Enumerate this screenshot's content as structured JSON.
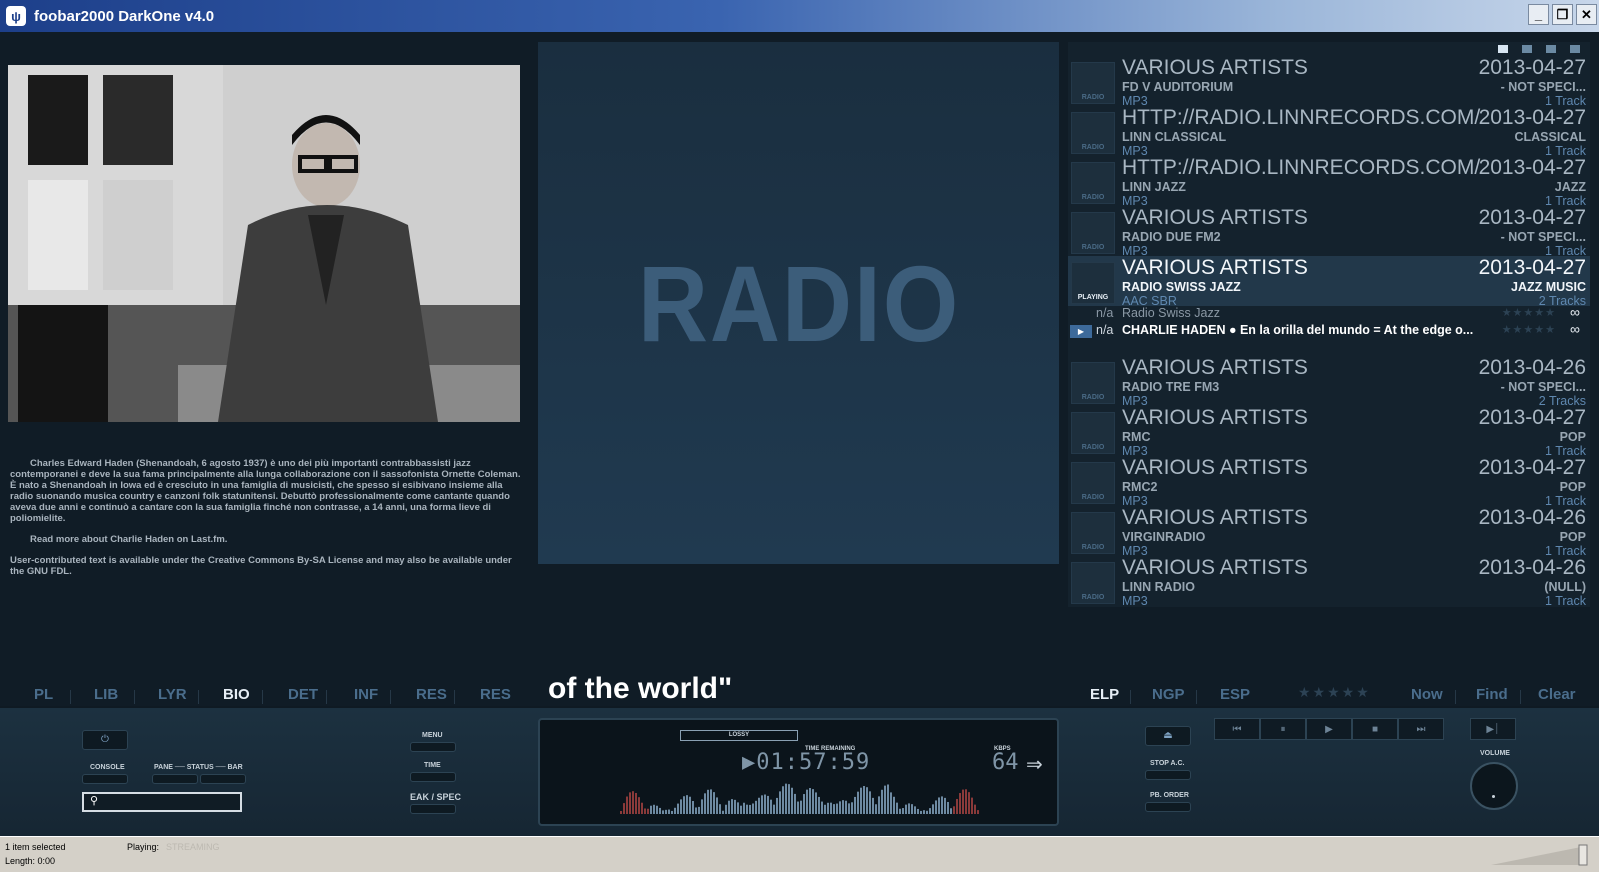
{
  "window": {
    "title": "foobar2000 DarkOne v4.0",
    "logo": "fox-icon"
  },
  "window_buttons": [
    "_",
    "❐",
    "✕"
  ],
  "bio": {
    "paragraphs": [
      "Charles Edward Haden (Shenandoah, 6 agosto 1937) è uno dei più importanti contrabbassisti jazz contemporanei e deve la sua fama principalmente alla lunga collaborazione con il sassofonista Ornette Coleman. È nato a Shenandoah in Iowa ed è cresciuto in una famiglia di musicisti, che spesso si esibivano insieme alla radio suonando musica country e canzoni folk statunitensi. Debuttò professionalmente come cantante quando aveva due anni e continuò a cantare con la sua famiglia finché non contrasse, a 14 anni, una forma lieve di poliomielite.",
      "Read more about Charlie Haden on Last.fm.",
      "User-contributed text is available under the Creative Commons By-SA License and may also be available under the GNU FDL."
    ]
  },
  "radio_panel": {
    "text": "RADIO"
  },
  "playlist": {
    "groups_top": [
      {
        "artist": "VARIOUS ARTISTS",
        "date": "2013-04-27",
        "album": "FD V AUDITORIUM",
        "genre": "- NOT SPECI...",
        "codec": "MP3",
        "tracks": "1 Track",
        "thumb": "RADIO"
      },
      {
        "artist": "HTTP://RADIO.LINNRECORDS.COM/",
        "date": "2013-04-27",
        "album": "LINN CLASSICAL",
        "genre": "CLASSICAL",
        "codec": "MP3",
        "tracks": "1 Track",
        "thumb": "RADIO"
      },
      {
        "artist": "HTTP://RADIO.LINNRECORDS.COM/",
        "date": "2013-04-27",
        "album": "LINN JAZZ",
        "genre": "JAZZ",
        "codec": "MP3",
        "tracks": "1 Track",
        "thumb": "RADIO"
      },
      {
        "artist": "VARIOUS ARTISTS",
        "date": "2013-04-27",
        "album": "RADIO DUE FM2",
        "genre": "- NOT SPECI...",
        "codec": "MP3",
        "tracks": "1 Track",
        "thumb": "RADIO"
      }
    ],
    "playing_group": {
      "artist": "VARIOUS ARTISTS",
      "date": "2013-04-27",
      "album": "RADIO SWISS JAZZ",
      "genre": "JAZZ MUSIC",
      "codec": "AAC SBR",
      "tracks": "2 Tracks",
      "thumb": "PLAYING"
    },
    "tracks": [
      {
        "na": "n/a",
        "name": "Radio Swiss Jazz",
        "stars": "★★★★★",
        "inf": "∞"
      },
      {
        "na": "n/a",
        "name": "CHARLIE HADEN ● En la orilla del mundo = At the edge o...",
        "stars": "★★★★★",
        "inf": "∞"
      }
    ],
    "groups_bottom": [
      {
        "artist": "VARIOUS ARTISTS",
        "date": "2013-04-26",
        "album": "RADIO TRE FM3",
        "genre": "- NOT SPECI...",
        "codec": "MP3",
        "tracks": "2 Tracks",
        "thumb": "RADIO"
      },
      {
        "artist": "VARIOUS ARTISTS",
        "date": "2013-04-27",
        "album": "RMC",
        "genre": "POP",
        "codec": "MP3",
        "tracks": "1 Track",
        "thumb": "RADIO"
      },
      {
        "artist": "VARIOUS ARTISTS",
        "date": "2013-04-27",
        "album": "RMC2",
        "genre": "POP",
        "codec": "MP3",
        "tracks": "1 Track",
        "thumb": "RADIO"
      },
      {
        "artist": "VARIOUS ARTISTS",
        "date": "2013-04-26",
        "album": "VIRGINRADIO",
        "genre": "POP",
        "codec": "MP3",
        "tracks": "1 Track",
        "thumb": "RADIO"
      },
      {
        "artist": "VARIOUS ARTISTS",
        "date": "2013-04-26",
        "album": "LINN RADIO",
        "genre": "(NULL)",
        "codec": "MP3",
        "tracks": "1 Track",
        "thumb": "RADIO"
      }
    ]
  },
  "tabs_left": [
    "PL",
    "LIB",
    "LYR",
    "BIO",
    "DET",
    "INF",
    "RES",
    "RES"
  ],
  "tabs_left_active": "BIO",
  "lyric": "of the world\"",
  "tabs_right": [
    "ELP",
    "NGP",
    "ESP"
  ],
  "tabs_right_active": "ELP",
  "right_stars": "★★★★★",
  "right_actions": [
    "Now",
    "Find",
    "Clear"
  ],
  "controls": {
    "console": "CONSOLE",
    "pane": "PANE ── STATUS ── BAR",
    "menu": "MENU",
    "time": "TIME",
    "peak": "EAK / SPEC",
    "stop_ac": "STOP A.C.",
    "pb_order": "PB. ORDER",
    "volume": "VOLUME",
    "search_icon": "search-icon"
  },
  "display": {
    "lossy": "LOSSY",
    "time_label": "TIME   REMAINING",
    "time": "01:57:59",
    "kbps_label": "KBPS",
    "kbps": "64"
  },
  "status": {
    "selected": "1 item selected",
    "length": "Length: 0:00",
    "playing_label": "Playing:",
    "streaming": "STREAMING"
  }
}
